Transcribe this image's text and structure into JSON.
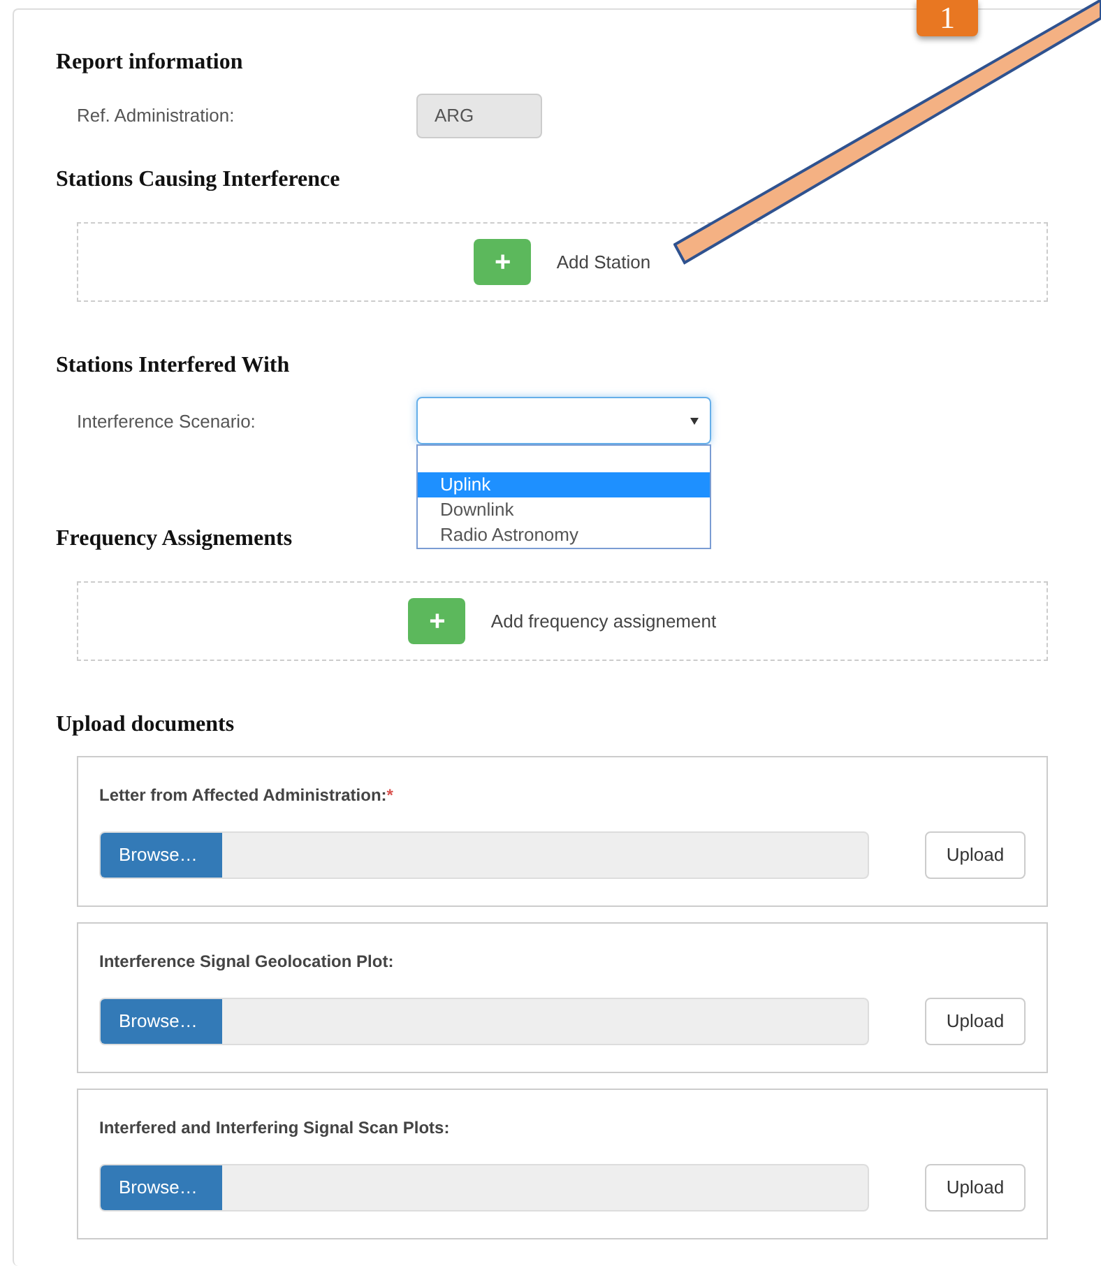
{
  "sections": [
    {
      "kind": "field",
      "title": "Report information",
      "label": "Ref. Administration:",
      "value": "ARG",
      "disabled": true
    },
    {
      "kind": "add",
      "title": "Stations Causing Interference",
      "button": "+",
      "action": "Add Station"
    },
    {
      "kind": "select",
      "title": "Stations Interfered With",
      "label": "Interference Scenario:",
      "expanded": true,
      "blank_option": true,
      "options": [
        {
          "label": "Uplink",
          "selected": true
        },
        {
          "label": "Downlink",
          "selected": false
        },
        {
          "label": "Radio Astronomy",
          "selected": false
        }
      ]
    },
    {
      "kind": "add",
      "title": "Frequency Assignements",
      "button": "+",
      "action": "Add frequency assignement"
    },
    {
      "kind": "uploads",
      "title": "Upload documents",
      "items": [
        {
          "label": "Letter from Affected Administration:",
          "required_mark": "*",
          "browse": "Browse…",
          "upload": "Upload"
        },
        {
          "label": "Interference Signal Geolocation Plot:",
          "browse": "Browse…",
          "upload": "Upload"
        },
        {
          "label": "Interfered and Interfering Signal Scan Plots:",
          "browse": "Browse…",
          "upload": "Upload"
        }
      ]
    }
  ],
  "callout": {
    "number": "1"
  }
}
